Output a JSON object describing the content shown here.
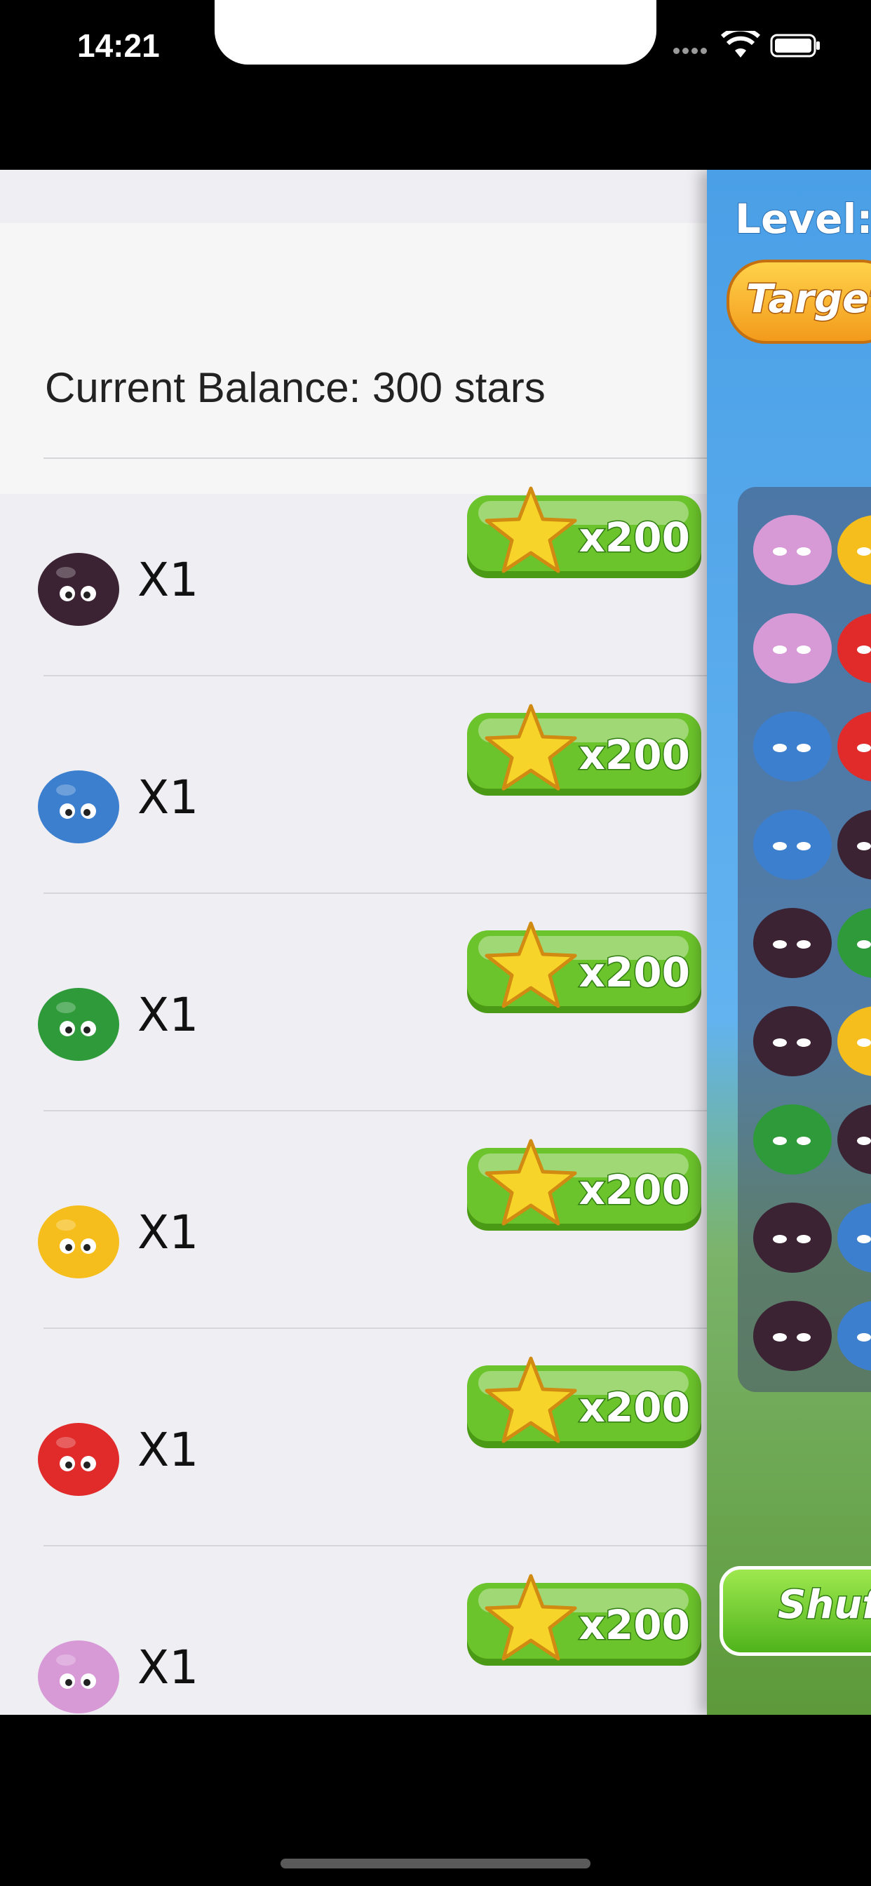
{
  "status_bar": {
    "time": "14:21"
  },
  "balance": {
    "text": "Current Balance: 300 stars"
  },
  "shop_items": [
    {
      "monster": "dark-purple-monster-icon",
      "color": "#3b2334",
      "quantity": "X1",
      "price": "x200"
    },
    {
      "monster": "blue-monster-icon",
      "color": "#3d7fcf",
      "quantity": "X1",
      "price": "x200"
    },
    {
      "monster": "green-monster-icon",
      "color": "#2e9a3a",
      "quantity": "X1",
      "price": "x200"
    },
    {
      "monster": "yellow-monster-icon",
      "color": "#f6be1c",
      "quantity": "X1",
      "price": "x200"
    },
    {
      "monster": "red-monster-icon",
      "color": "#e12a2a",
      "quantity": "X1",
      "price": "x200"
    },
    {
      "monster": "pink-monster-icon",
      "color": "#d79ad6",
      "quantity": "X1",
      "price": "x200"
    }
  ],
  "game": {
    "level_label": "Level:",
    "target_label": "Target:",
    "shuffle_label": "Shuf"
  },
  "colors": {
    "buy_button": "#6cc42c",
    "star": "#f7d42a",
    "sky": "#62b3f0"
  }
}
